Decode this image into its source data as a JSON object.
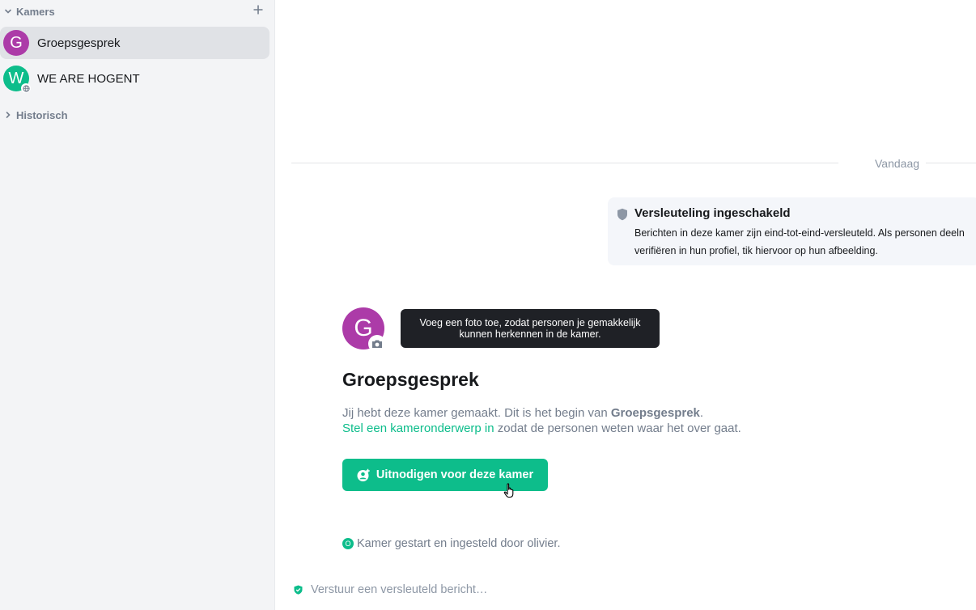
{
  "sidebar": {
    "rooms_section": {
      "label": "Kamers"
    },
    "rooms": [
      {
        "name": "Groepsgesprek",
        "avatar_letter": "G",
        "avatar_color": "#ac3ba8",
        "active": true
      },
      {
        "name": "WE ARE HOGENT",
        "avatar_letter": "W",
        "avatar_color": "#0dbd8b",
        "active": false
      }
    ],
    "historical_section": {
      "label": "Historisch"
    }
  },
  "timeline": {
    "date_separator": "Vandaag",
    "encryption": {
      "title": "Versleuteling ingeschakeld",
      "body_line1": "Berichten in deze kamer zijn eind-tot-eind-versleuteld. Als personen deeln",
      "body_line2": "verifiëren in hun profiel, tik hiervoor op hun afbeelding."
    },
    "room_intro": {
      "avatar_letter": "G",
      "avatar_tooltip": "Voeg een foto toe, zodat personen je gemakkelijk kunnen herkennen in de kamer.",
      "room_name": "Groepsgesprek",
      "created_prefix": "Jij hebt deze kamer gemaakt. Dit is het begin van ",
      "created_room": "Groepsgesprek",
      "created_suffix": ".",
      "topic_link": "Stel een kameronderwerp in",
      "topic_suffix": " zodat de personen weten waar het over gaat.",
      "invite_label": "Uitnodigen voor deze kamer"
    },
    "event": {
      "avatar_letter": "O",
      "text": "Kamer gestart en ingesteld door olivier."
    }
  },
  "composer": {
    "placeholder": "Verstuur een versleuteld bericht…"
  },
  "colors": {
    "accent": "#0dbd8b",
    "room_avatar_purple": "#ac3ba8",
    "secondary_text": "#737d8c"
  }
}
